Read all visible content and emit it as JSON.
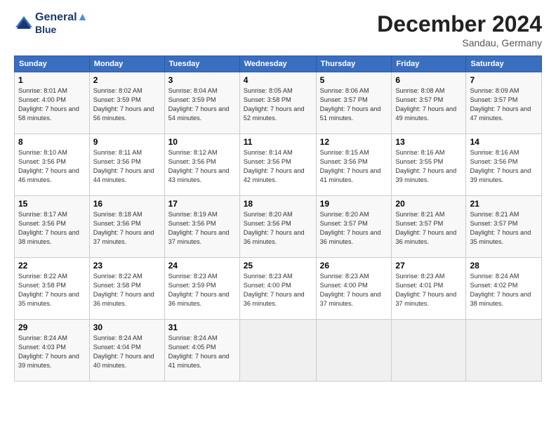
{
  "header": {
    "logo_line1": "General",
    "logo_line2": "Blue",
    "month": "December 2024",
    "location": "Sandau, Germany"
  },
  "weekdays": [
    "Sunday",
    "Monday",
    "Tuesday",
    "Wednesday",
    "Thursday",
    "Friday",
    "Saturday"
  ],
  "weeks": [
    [
      {
        "day": "1",
        "sunrise": "8:01 AM",
        "sunset": "4:00 PM",
        "daylight": "7 hours and 58 minutes."
      },
      {
        "day": "2",
        "sunrise": "8:02 AM",
        "sunset": "3:59 PM",
        "daylight": "7 hours and 56 minutes."
      },
      {
        "day": "3",
        "sunrise": "8:04 AM",
        "sunset": "3:59 PM",
        "daylight": "7 hours and 54 minutes."
      },
      {
        "day": "4",
        "sunrise": "8:05 AM",
        "sunset": "3:58 PM",
        "daylight": "7 hours and 52 minutes."
      },
      {
        "day": "5",
        "sunrise": "8:06 AM",
        "sunset": "3:57 PM",
        "daylight": "7 hours and 51 minutes."
      },
      {
        "day": "6",
        "sunrise": "8:08 AM",
        "sunset": "3:57 PM",
        "daylight": "7 hours and 49 minutes."
      },
      {
        "day": "7",
        "sunrise": "8:09 AM",
        "sunset": "3:57 PM",
        "daylight": "7 hours and 47 minutes."
      }
    ],
    [
      {
        "day": "8",
        "sunrise": "8:10 AM",
        "sunset": "3:56 PM",
        "daylight": "7 hours and 46 minutes."
      },
      {
        "day": "9",
        "sunrise": "8:11 AM",
        "sunset": "3:56 PM",
        "daylight": "7 hours and 44 minutes."
      },
      {
        "day": "10",
        "sunrise": "8:12 AM",
        "sunset": "3:56 PM",
        "daylight": "7 hours and 43 minutes."
      },
      {
        "day": "11",
        "sunrise": "8:14 AM",
        "sunset": "3:56 PM",
        "daylight": "7 hours and 42 minutes."
      },
      {
        "day": "12",
        "sunrise": "8:15 AM",
        "sunset": "3:56 PM",
        "daylight": "7 hours and 41 minutes."
      },
      {
        "day": "13",
        "sunrise": "8:16 AM",
        "sunset": "3:55 PM",
        "daylight": "7 hours and 39 minutes."
      },
      {
        "day": "14",
        "sunrise": "8:16 AM",
        "sunset": "3:56 PM",
        "daylight": "7 hours and 39 minutes."
      }
    ],
    [
      {
        "day": "15",
        "sunrise": "8:17 AM",
        "sunset": "3:56 PM",
        "daylight": "7 hours and 38 minutes."
      },
      {
        "day": "16",
        "sunrise": "8:18 AM",
        "sunset": "3:56 PM",
        "daylight": "7 hours and 37 minutes."
      },
      {
        "day": "17",
        "sunrise": "8:19 AM",
        "sunset": "3:56 PM",
        "daylight": "7 hours and 37 minutes."
      },
      {
        "day": "18",
        "sunrise": "8:20 AM",
        "sunset": "3:56 PM",
        "daylight": "7 hours and 36 minutes."
      },
      {
        "day": "19",
        "sunrise": "8:20 AM",
        "sunset": "3:57 PM",
        "daylight": "7 hours and 36 minutes."
      },
      {
        "day": "20",
        "sunrise": "8:21 AM",
        "sunset": "3:57 PM",
        "daylight": "7 hours and 36 minutes."
      },
      {
        "day": "21",
        "sunrise": "8:21 AM",
        "sunset": "3:57 PM",
        "daylight": "7 hours and 35 minutes."
      }
    ],
    [
      {
        "day": "22",
        "sunrise": "8:22 AM",
        "sunset": "3:58 PM",
        "daylight": "7 hours and 35 minutes."
      },
      {
        "day": "23",
        "sunrise": "8:22 AM",
        "sunset": "3:58 PM",
        "daylight": "7 hours and 36 minutes."
      },
      {
        "day": "24",
        "sunrise": "8:23 AM",
        "sunset": "3:59 PM",
        "daylight": "7 hours and 36 minutes."
      },
      {
        "day": "25",
        "sunrise": "8:23 AM",
        "sunset": "4:00 PM",
        "daylight": "7 hours and 36 minutes."
      },
      {
        "day": "26",
        "sunrise": "8:23 AM",
        "sunset": "4:00 PM",
        "daylight": "7 hours and 37 minutes."
      },
      {
        "day": "27",
        "sunrise": "8:23 AM",
        "sunset": "4:01 PM",
        "daylight": "7 hours and 37 minutes."
      },
      {
        "day": "28",
        "sunrise": "8:24 AM",
        "sunset": "4:02 PM",
        "daylight": "7 hours and 38 minutes."
      }
    ],
    [
      {
        "day": "29",
        "sunrise": "8:24 AM",
        "sunset": "4:03 PM",
        "daylight": "7 hours and 39 minutes."
      },
      {
        "day": "30",
        "sunrise": "8:24 AM",
        "sunset": "4:04 PM",
        "daylight": "7 hours and 40 minutes."
      },
      {
        "day": "31",
        "sunrise": "8:24 AM",
        "sunset": "4:05 PM",
        "daylight": "7 hours and 41 minutes."
      },
      null,
      null,
      null,
      null
    ]
  ]
}
